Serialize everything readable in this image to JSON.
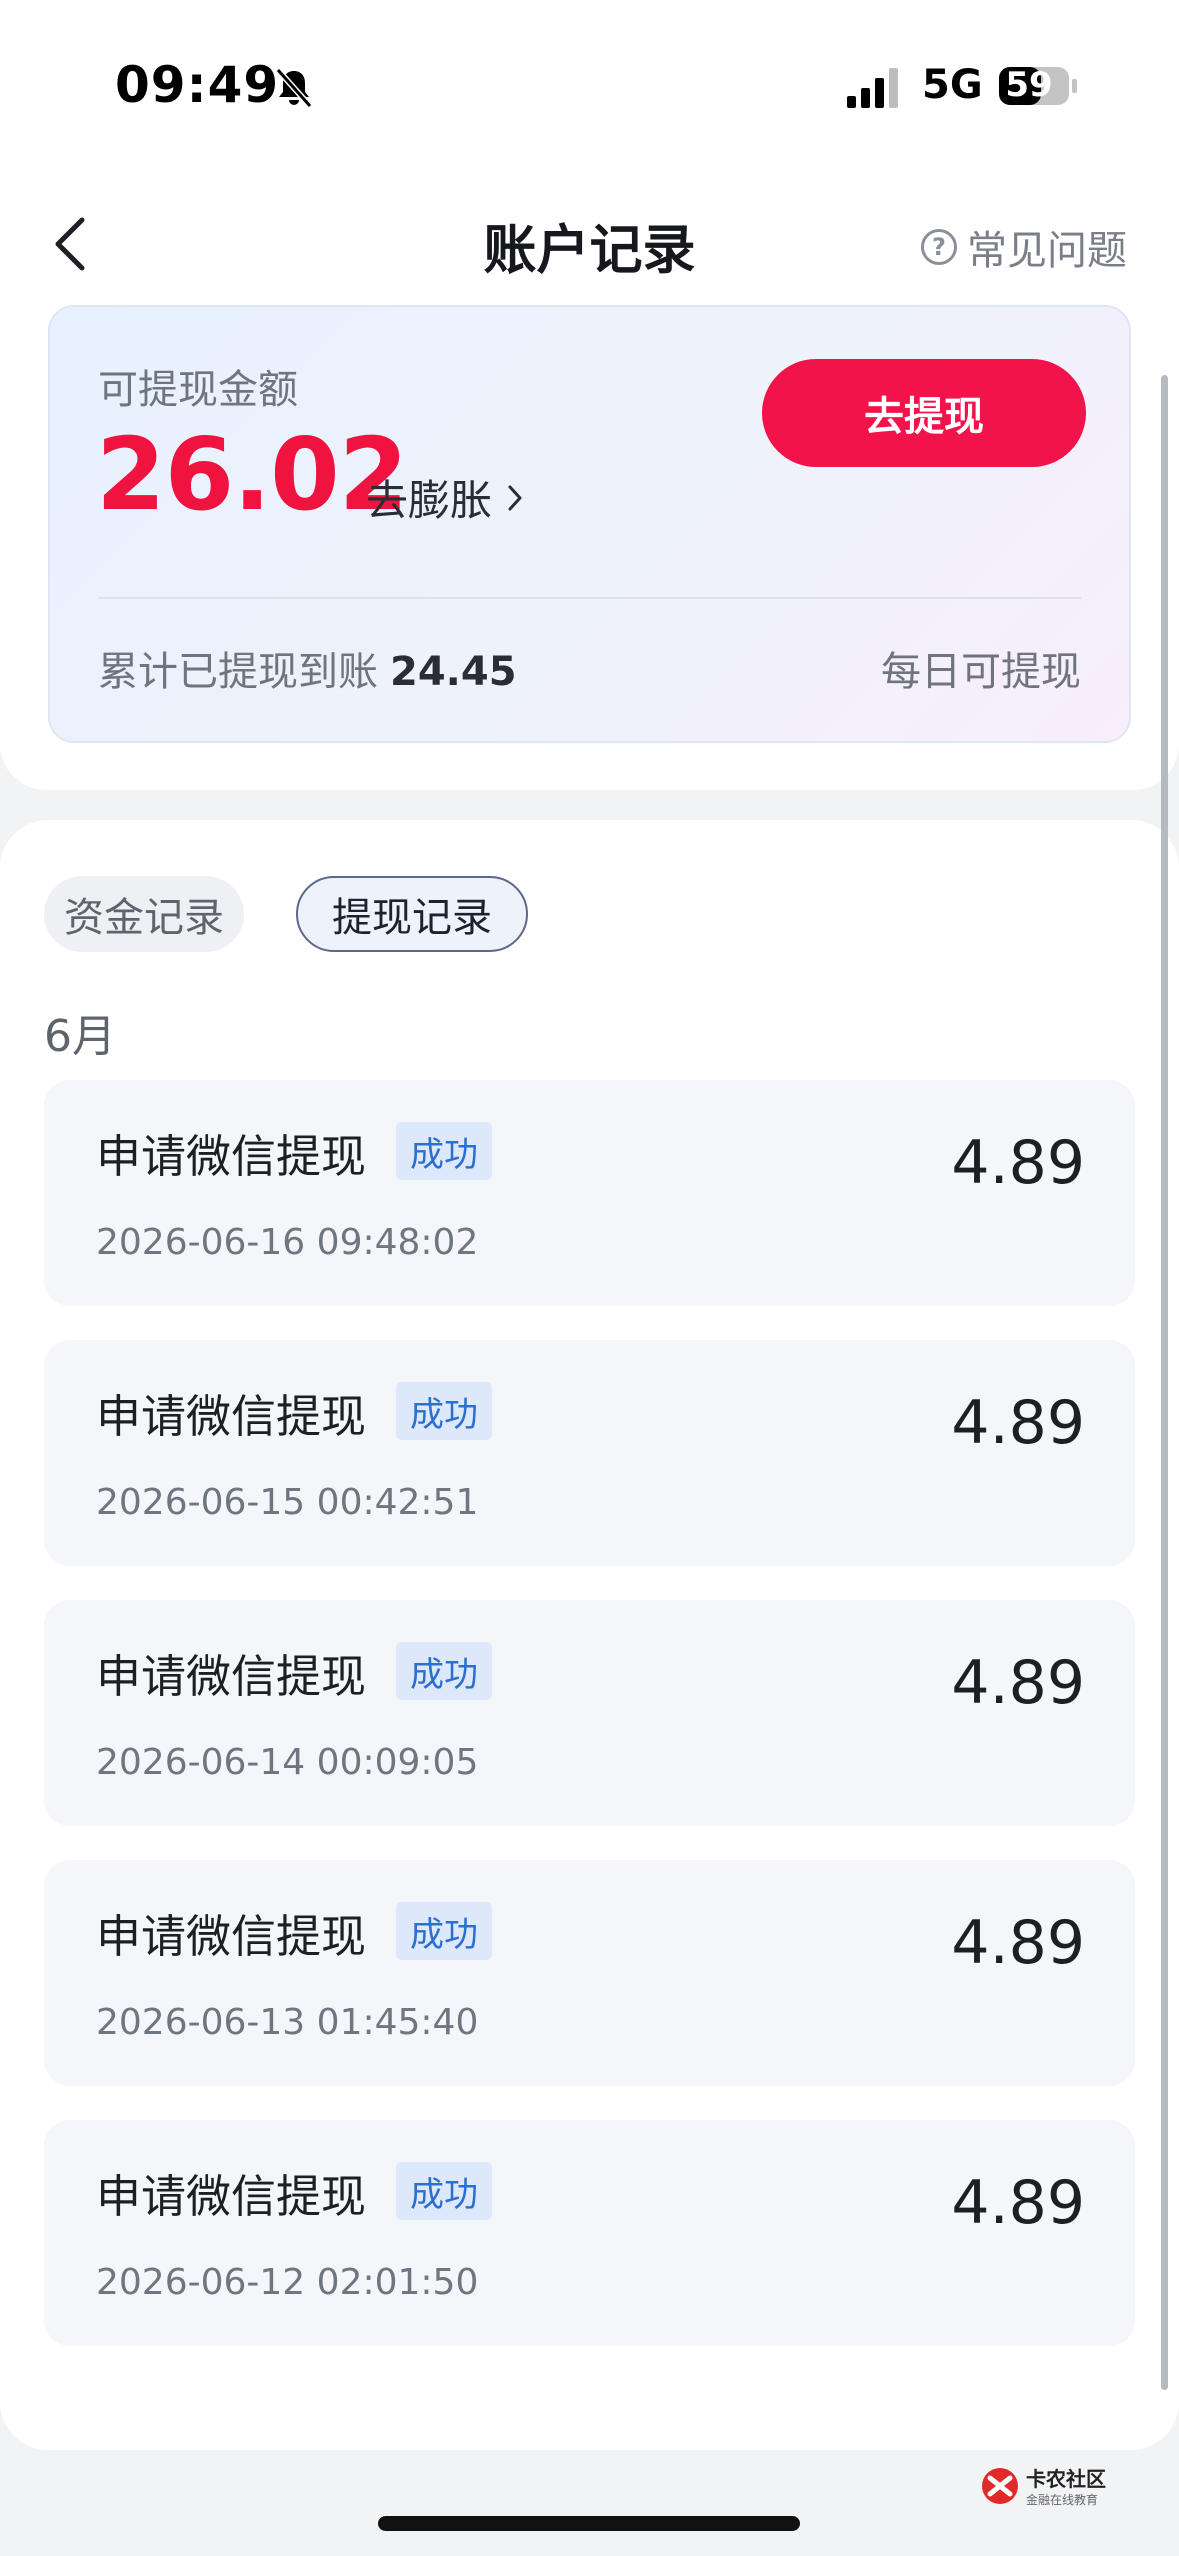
{
  "status_bar": {
    "time": "09:49",
    "network": "5G",
    "battery": "59"
  },
  "nav": {
    "title": "账户记录",
    "faq_label": "常见问题"
  },
  "balance_card": {
    "label": "可提现金额",
    "amount": "26.02",
    "expand_label": "去膨胀",
    "withdraw_button": "去提现",
    "cumulative_label": "累计已提现到账",
    "cumulative_amount": "24.45",
    "daily_label": "每日可提现"
  },
  "tabs": [
    "资金记录",
    "提现记录"
  ],
  "active_tab": "提现记录",
  "month": "6月",
  "records": [
    {
      "title": "申请微信提现",
      "status": "成功",
      "time": "2026-06-16 09:48:02",
      "amount": "4.89"
    },
    {
      "title": "申请微信提现",
      "status": "成功",
      "time": "2026-06-15 00:42:51",
      "amount": "4.89"
    },
    {
      "title": "申请微信提现",
      "status": "成功",
      "time": "2026-06-14 00:09:05",
      "amount": "4.89"
    },
    {
      "title": "申请微信提现",
      "status": "成功",
      "time": "2026-06-13 01:45:40",
      "amount": "4.89"
    },
    {
      "title": "申请微信提现",
      "status": "成功",
      "time": "2026-06-12 02:01:50",
      "amount": "4.89"
    }
  ],
  "watermark": {
    "name": "卡农社区",
    "tagline": "金融在线教育"
  },
  "colors": {
    "accent_red": "#f2134a",
    "amount_red": "#f0123f",
    "badge_blue": "#2b6fd0"
  }
}
